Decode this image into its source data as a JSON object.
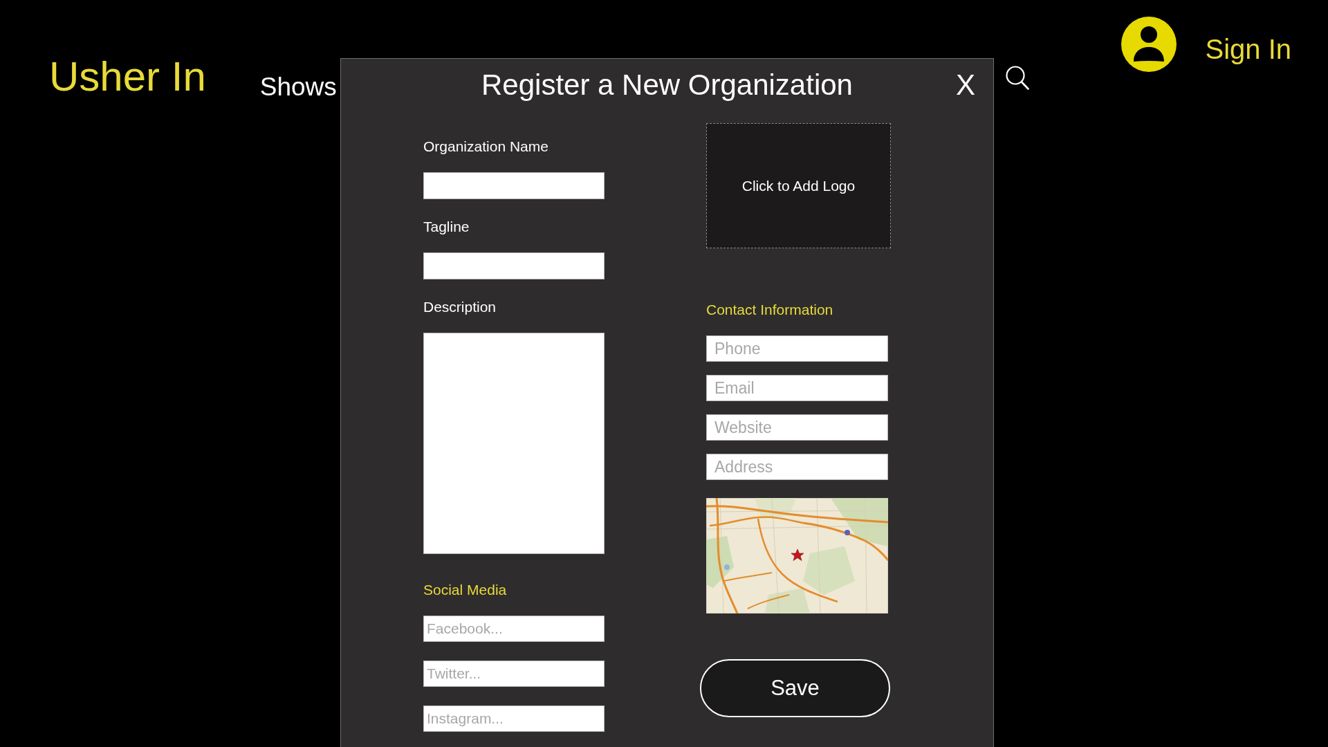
{
  "header": {
    "logo": "Usher In",
    "nav": [
      {
        "label": "Shows"
      }
    ],
    "sign_in": "Sign In"
  },
  "dialog": {
    "title": "Register a New Organization",
    "close": "X",
    "fields": [
      {
        "kind": "input",
        "label": "Organization Name"
      },
      {
        "kind": "input",
        "label": "Tagline"
      },
      {
        "kind": "textarea",
        "label": "Description"
      }
    ],
    "social_media": {
      "heading": "Social Media",
      "fields": [
        {
          "placeholder": "Facebook..."
        },
        {
          "placeholder": "Twitter..."
        },
        {
          "placeholder": "Instagram..."
        }
      ]
    },
    "logo_upload": {
      "label": "Click to Add Logo"
    },
    "contact": {
      "heading": "Contact Information",
      "fields": [
        {
          "placeholder": "Phone"
        },
        {
          "placeholder": "Email"
        },
        {
          "placeholder": "Website"
        },
        {
          "placeholder": "Address"
        }
      ]
    },
    "save": "Save"
  }
}
